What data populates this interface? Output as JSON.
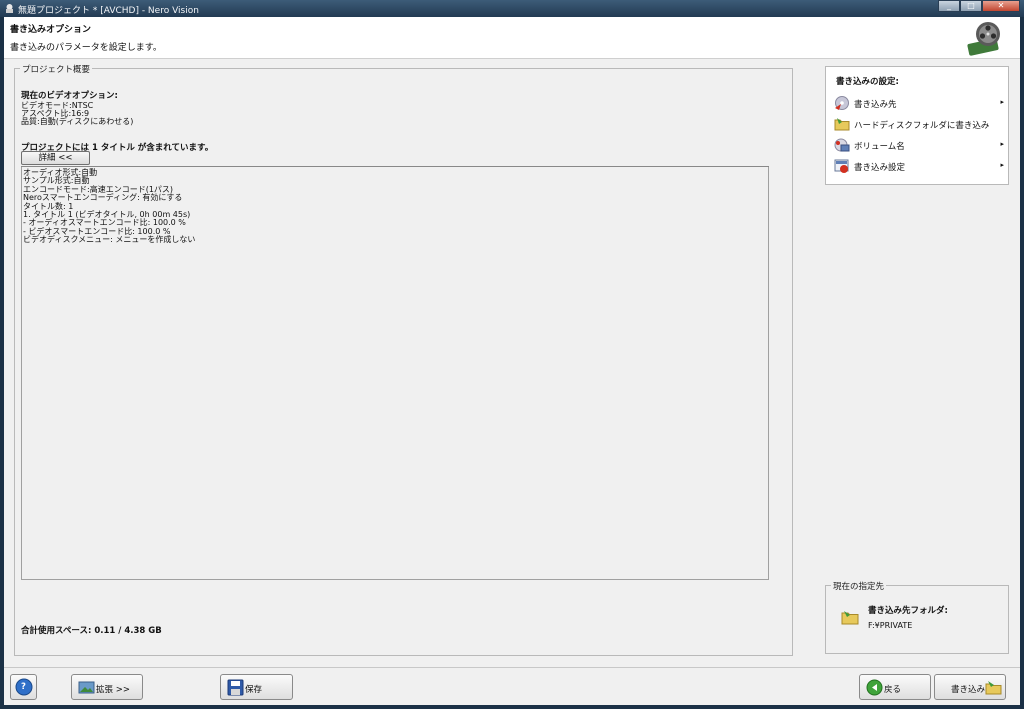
{
  "window": {
    "title": "無題プロジェクト * [AVCHD] - Nero Vision",
    "buttons": [
      "minimize",
      "maximize",
      "close"
    ]
  },
  "header": {
    "title": "書き込みオプション",
    "subtitle": "書き込みのパラメータを設定します。",
    "icon": "film-reel-icon"
  },
  "summary": {
    "legend": "プロジェクト概要",
    "current_options_label": "現在のビデオオプション:",
    "options": [
      "ビデオモード:NTSC",
      "アスペクト比:16:9",
      "品質:自動(ディスクにあわせる)"
    ],
    "titles_line": "プロジェクトには 1 タイトル が含まれています。",
    "details_button": "詳細 <<",
    "details_lines": [
      "オーディオ形式:自動",
      "サンプル形式:自動",
      "エンコードモード:高速エンコード(1パス)",
      "Neroスマートエンコーディング: 有効にする",
      "",
      "タイトル数: 1",
      "1. タイトル 1 (ビデオタイトル, 0h 00m 45s)",
      "- オーディオスマートエンコード比: 100.0 %",
      "- ビデオスマートエンコード比: 100.0 %",
      "",
      "ビデオディスクメニュー: メニューを作成しない"
    ],
    "total_space": "合計使用スペース: 0.11 / 4.38 GB"
  },
  "burn_settings": {
    "title": "書き込みの設定:",
    "items": [
      {
        "label": "書き込み先",
        "icon": "disc-burn-icon",
        "has_submenu": true
      },
      {
        "label": "ハードディスクフォルダに書き込み",
        "icon": "folder-icon",
        "has_submenu": false
      },
      {
        "label": "ボリューム名",
        "icon": "volume-label-icon",
        "has_submenu": true
      },
      {
        "label": "書き込み設定",
        "icon": "burn-settings-icon",
        "has_submenu": true
      }
    ],
    "submenu_arrow": "▸"
  },
  "destination": {
    "legend": "現在の指定先",
    "title": "書き込み先フォルダ:",
    "path": "F:¥PRIVATE"
  },
  "bottom": {
    "help": "?",
    "expand": "拡張 >>",
    "save": "保存",
    "back": "戻る",
    "burn": "書き込み"
  }
}
